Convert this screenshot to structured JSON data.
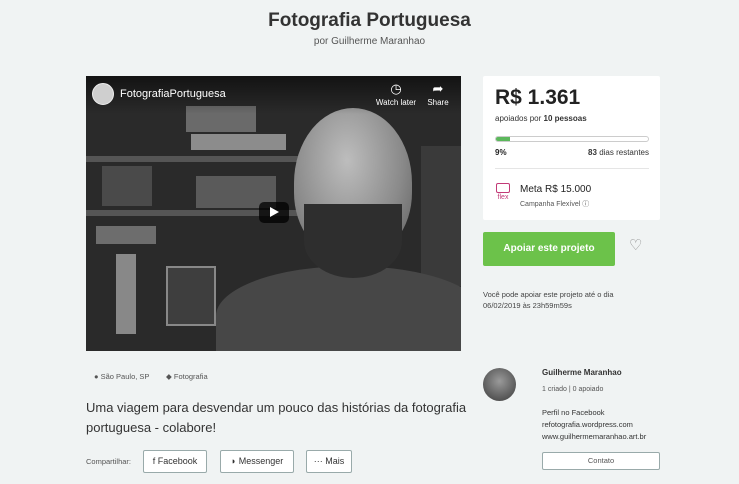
{
  "header": {
    "title": "Fotografia Portuguesa",
    "subtitle": "por Guilherme Maranhao"
  },
  "video": {
    "channel_name": "FotografiaPortuguesa",
    "watch_later_label": "Watch later",
    "share_label": "Share",
    "icons": {
      "watch_later": "clock-icon",
      "share": "share-arrow-icon",
      "play": "play-icon"
    }
  },
  "stats": {
    "amount": "R$ 1.361",
    "backers_prefix": "apoiados por",
    "backers_count": "10 pessoas",
    "progress_percent": 9,
    "progress_label": "9%",
    "days_count": "83",
    "days_label": "dias restantes",
    "flex_label": "flex",
    "goal_label": "Meta R$ 15.000",
    "campaign_label": "Campanha Flexível",
    "progress_color": "#5cb85c",
    "flex_color": "#c23a77"
  },
  "actions": {
    "support_button": "Apoiar este projeto",
    "support_color": "#6cc24a",
    "favorite_icon": "heart-icon",
    "deadline_text": "Você pode apoiar este projeto até o dia 06/02/2019 às 23h59m59s"
  },
  "tags": {
    "location": "São Paulo, SP",
    "category": "Fotografia"
  },
  "pitch": "Uma viagem para desvendar um pouco das histórias da fotografia portuguesa - colabore!",
  "share": {
    "label": "Compartilhar:",
    "facebook": "Facebook",
    "messenger": "Messenger",
    "more": "··· Mais"
  },
  "creator": {
    "name": "Guilherme Maranhao",
    "stats": "1 criado  |  0 apoiado",
    "links": [
      "Perfil no Facebook",
      "refotografia.wordpress.com",
      "www.guilhermemaranhao.art.br"
    ],
    "contact_button": "Contato"
  }
}
